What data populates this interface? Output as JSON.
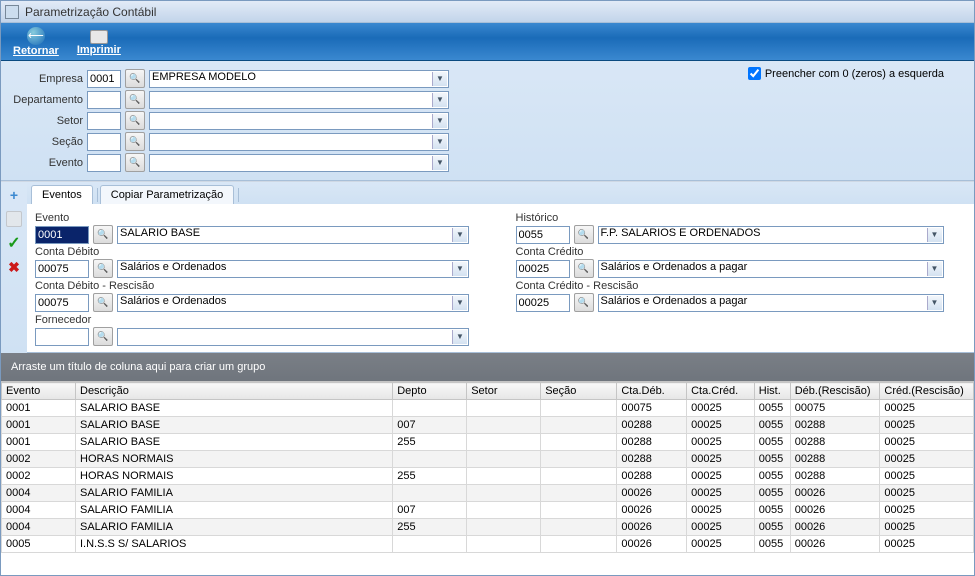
{
  "window": {
    "title": "Parametrização Contábil"
  },
  "toolbar": {
    "back": "Retornar",
    "print": "Imprimir"
  },
  "filters": {
    "empresa_label": "Empresa",
    "empresa_code": "0001",
    "empresa_desc": "EMPRESA MODELO",
    "departamento_label": "Departamento",
    "departamento_code": "",
    "departamento_desc": "",
    "setor_label": "Setor",
    "setor_code": "",
    "setor_desc": "",
    "secao_label": "Seção",
    "secao_code": "",
    "secao_desc": "",
    "evento_label": "Evento",
    "evento_code": "",
    "evento_desc": "",
    "zero_pad_label": "Preencher com 0 (zeros) a esquerda",
    "zero_pad_checked": true
  },
  "tabs": {
    "eventos": "Eventos",
    "copiar": "Copiar Parametrização"
  },
  "form": {
    "evento_label": "Evento",
    "evento_code": "0001",
    "evento_desc": "SALARIO BASE",
    "historico_label": "Histórico",
    "historico_code": "0055",
    "historico_desc": "F.P. SALARIOS E ORDENADOS",
    "conta_deb_label": "Conta Débito",
    "conta_deb_code": "00075",
    "conta_deb_desc": "Salários e Ordenados",
    "conta_cred_label": "Conta Crédito",
    "conta_cred_code": "00025",
    "conta_cred_desc": "Salários e Ordenados a pagar",
    "conta_deb_resc_label": "Conta Débito - Rescisão",
    "conta_deb_resc_code": "00075",
    "conta_deb_resc_desc": "Salários e Ordenados",
    "conta_cred_resc_label": "Conta Crédito - Rescisão",
    "conta_cred_resc_code": "00025",
    "conta_cred_resc_desc": "Salários e Ordenados a pagar",
    "fornecedor_label": "Fornecedor",
    "fornecedor_code": "",
    "fornecedor_desc": ""
  },
  "grid": {
    "drag_hint": "Arraste um título de coluna aqui para criar um grupo",
    "headers": {
      "evento": "Evento",
      "descricao": "Descrição",
      "depto": "Depto",
      "setor": "Setor",
      "secao": "Seção",
      "cta_deb": "Cta.Déb.",
      "cta_cred": "Cta.Créd.",
      "hist": "Hist.",
      "deb_resc": "Déb.(Rescisão)",
      "cred_resc": "Créd.(Rescisão)"
    },
    "rows": [
      {
        "evento": "0001",
        "descricao": "SALARIO BASE",
        "depto": "",
        "setor": "",
        "secao": "",
        "ctadeb": "00075",
        "ctacred": "00025",
        "hist": "0055",
        "debr": "00075",
        "credr": "00025"
      },
      {
        "evento": "0001",
        "descricao": "SALARIO BASE",
        "depto": "007",
        "setor": "",
        "secao": "",
        "ctadeb": "00288",
        "ctacred": "00025",
        "hist": "0055",
        "debr": "00288",
        "credr": "00025"
      },
      {
        "evento": "0001",
        "descricao": "SALARIO BASE",
        "depto": "255",
        "setor": "",
        "secao": "",
        "ctadeb": "00288",
        "ctacred": "00025",
        "hist": "0055",
        "debr": "00288",
        "credr": "00025"
      },
      {
        "evento": "0002",
        "descricao": "HORAS NORMAIS",
        "depto": "",
        "setor": "",
        "secao": "",
        "ctadeb": "00288",
        "ctacred": "00025",
        "hist": "0055",
        "debr": "00288",
        "credr": "00025"
      },
      {
        "evento": "0002",
        "descricao": "HORAS NORMAIS",
        "depto": "255",
        "setor": "",
        "secao": "",
        "ctadeb": "00288",
        "ctacred": "00025",
        "hist": "0055",
        "debr": "00288",
        "credr": "00025"
      },
      {
        "evento": "0004",
        "descricao": "SALARIO FAMILIA",
        "depto": "",
        "setor": "",
        "secao": "",
        "ctadeb": "00026",
        "ctacred": "00025",
        "hist": "0055",
        "debr": "00026",
        "credr": "00025"
      },
      {
        "evento": "0004",
        "descricao": "SALARIO FAMILIA",
        "depto": "007",
        "setor": "",
        "secao": "",
        "ctadeb": "00026",
        "ctacred": "00025",
        "hist": "0055",
        "debr": "00026",
        "credr": "00025"
      },
      {
        "evento": "0004",
        "descricao": "SALARIO FAMILIA",
        "depto": "255",
        "setor": "",
        "secao": "",
        "ctadeb": "00026",
        "ctacred": "00025",
        "hist": "0055",
        "debr": "00026",
        "credr": "00025"
      },
      {
        "evento": "0005",
        "descricao": "I.N.S.S S/ SALARIOS",
        "depto": "",
        "setor": "",
        "secao": "",
        "ctadeb": "00026",
        "ctacred": "00025",
        "hist": "0055",
        "debr": "00026",
        "credr": "00025"
      }
    ]
  }
}
